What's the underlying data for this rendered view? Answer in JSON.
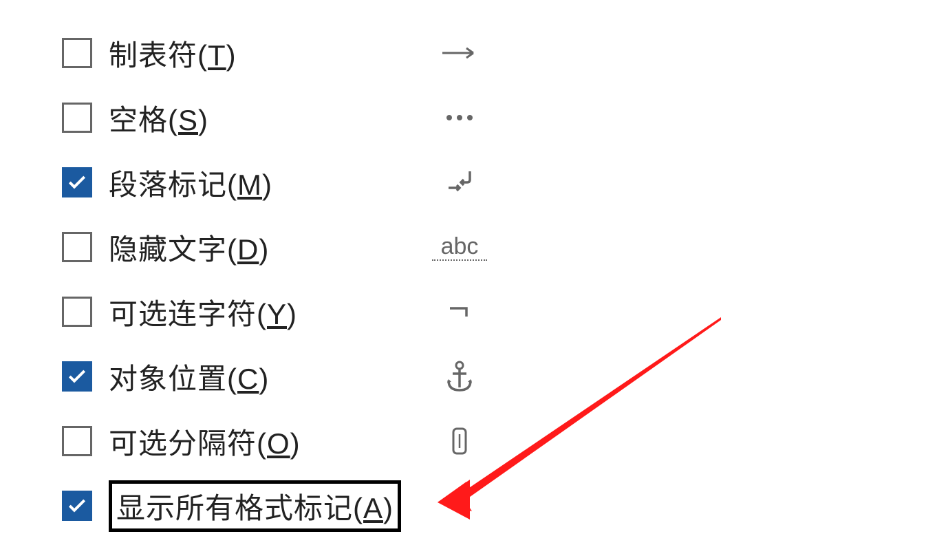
{
  "options": [
    {
      "label_pre": "制表符(",
      "hotkey": "T",
      "label_post": ")",
      "checked": false,
      "icon": "arrow-right"
    },
    {
      "label_pre": "空格(",
      "hotkey": "S",
      "label_post": ")",
      "checked": false,
      "icon": "dots"
    },
    {
      "label_pre": "段落标记(",
      "hotkey": "M",
      "label_post": ")",
      "checked": true,
      "icon": "paragraph-mark"
    },
    {
      "label_pre": "隐藏文字(",
      "hotkey": "D",
      "label_post": ")",
      "checked": false,
      "icon": "abc"
    },
    {
      "label_pre": "可选连字符(",
      "hotkey": "Y",
      "label_post": ")",
      "checked": false,
      "icon": "optional-hyphen"
    },
    {
      "label_pre": "对象位置(",
      "hotkey": "C",
      "label_post": ")",
      "checked": true,
      "icon": "anchor"
    },
    {
      "label_pre": "可选分隔符(",
      "hotkey": "O",
      "label_post": ")",
      "checked": false,
      "icon": "optional-break"
    },
    {
      "label_pre": "显示所有格式标记(",
      "hotkey": "A",
      "label_post": ")",
      "checked": true,
      "icon": "",
      "highlighted": true
    }
  ]
}
